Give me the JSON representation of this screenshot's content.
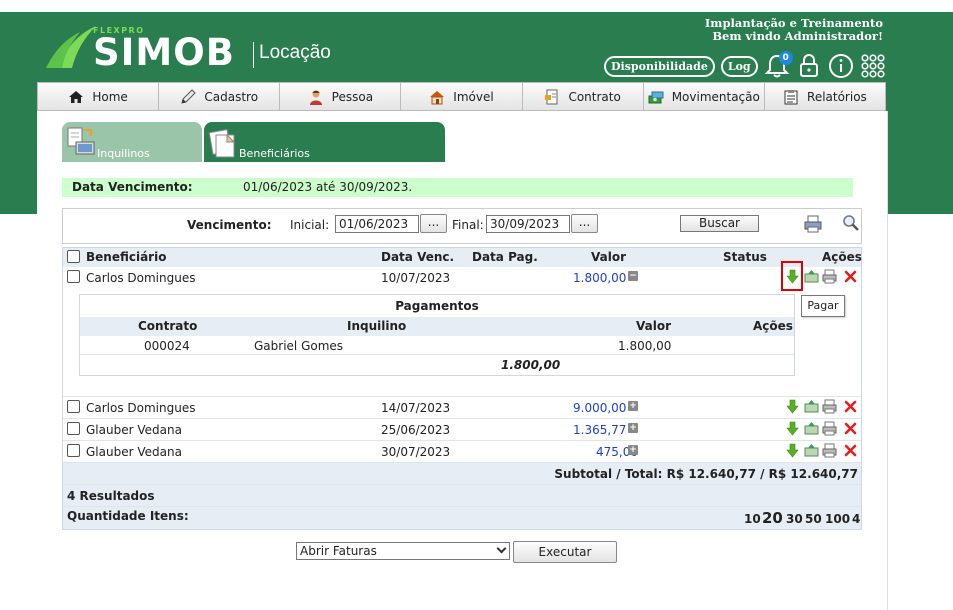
{
  "header": {
    "brand_small": "FLEXPRO",
    "brand": "SIMOB",
    "module": "Locação",
    "line1": "Implantação e Treinamento",
    "line2": "Bem vindo Administrador!",
    "btn_disponibilidade": "Disponibilidade",
    "btn_log": "Log",
    "notifications": "0"
  },
  "nav": [
    {
      "label": "Home",
      "icon": "home-icon"
    },
    {
      "label": "Cadastro",
      "icon": "pencil-icon"
    },
    {
      "label": "Pessoa",
      "icon": "person-icon"
    },
    {
      "label": "Imóvel",
      "icon": "house-icon"
    },
    {
      "label": "Contrato",
      "icon": "contract-icon"
    },
    {
      "label": "Movimentação",
      "icon": "money-icon"
    },
    {
      "label": "Relatórios",
      "icon": "report-icon"
    }
  ],
  "tabs": {
    "inquilinos": "Inquilinos",
    "beneficiarios": "Beneficiários"
  },
  "summary": {
    "label": "Data Vencimento:",
    "value": "01/06/2023 até 30/09/2023."
  },
  "filter": {
    "vencimento": "Vencimento:",
    "inicial_label": "Inicial:",
    "inicial": "01/06/2023",
    "final_label": "Final:",
    "final": "30/09/2023",
    "dots": "...",
    "buscar": "Buscar"
  },
  "table": {
    "headers": {
      "beneficiario": "Beneficiário",
      "data_venc": "Data Venc.",
      "data_pag": "Data Pag.",
      "valor": "Valor",
      "status": "Status",
      "acoes": "Ações"
    },
    "rows": [
      {
        "beneficiario": "Carlos Domingues",
        "data_venc": "10/07/2023",
        "valor": "1.800,00",
        "toggle": "−"
      },
      {
        "beneficiario": "Carlos Domingues",
        "data_venc": "14/07/2023",
        "valor": "9.000,00",
        "toggle": "+"
      },
      {
        "beneficiario": "Glauber Vedana",
        "data_venc": "25/06/2023",
        "valor": "1.365,77",
        "toggle": "+"
      },
      {
        "beneficiario": "Glauber Vedana",
        "data_venc": "30/07/2023",
        "valor": "475,00",
        "toggle": "+"
      }
    ],
    "subtotal": "Subtotal / Total: R$ 12.640,77 / R$ 12.640,77",
    "results": "4 Resultados",
    "qty_label": "Quantidade Itens:",
    "qty_options": [
      "10",
      "20",
      "30",
      "50",
      "100",
      "4"
    ]
  },
  "pagamentos": {
    "title": "Pagamentos",
    "headers": {
      "contrato": "Contrato",
      "inquilino": "Inquilino",
      "valor": "Valor",
      "acoes": "Ações"
    },
    "row": {
      "contrato": "000024",
      "inquilino": "Gabriel Gomes",
      "valor": "1.800,00"
    },
    "total": "1.800,00"
  },
  "tooltip": "Pagar",
  "bottom": {
    "select": "Abrir Faturas",
    "executar": "Executar"
  }
}
